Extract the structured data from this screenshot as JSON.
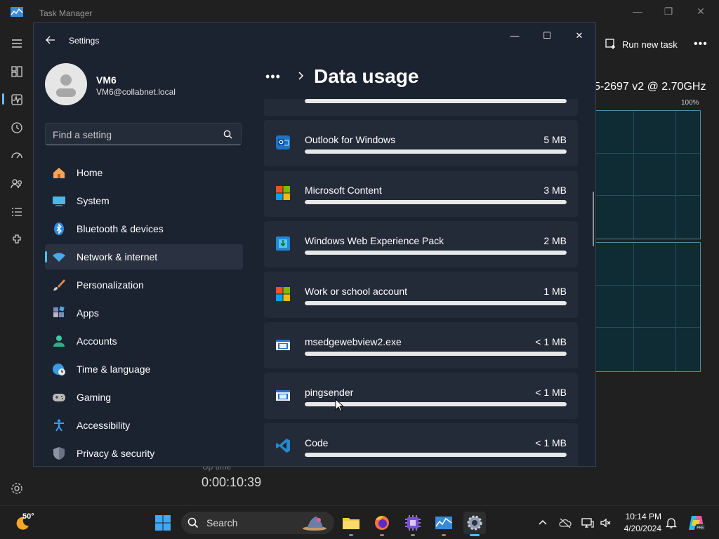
{
  "task_manager": {
    "title": "Task Manager",
    "run_new_task": "Run new task",
    "more": "•••",
    "cpu_name": "5-2697 v2 @ 2.70GHz",
    "graph_max": "100%",
    "uptime_label": "Up time",
    "uptime_value": "0:00:10:39"
  },
  "settings": {
    "title": "Settings",
    "user_name": "VM6",
    "user_email": "VM6@collabnet.local",
    "search_placeholder": "Find a setting",
    "breadcrumb_more": "•••",
    "page_title": "Data usage",
    "nav": [
      {
        "label": "Home",
        "icon": "home-icon"
      },
      {
        "label": "System",
        "icon": "system-icon"
      },
      {
        "label": "Bluetooth & devices",
        "icon": "bluetooth-icon"
      },
      {
        "label": "Network & internet",
        "icon": "wifi-icon",
        "selected": true
      },
      {
        "label": "Personalization",
        "icon": "brush-icon"
      },
      {
        "label": "Apps",
        "icon": "apps-icon"
      },
      {
        "label": "Accounts",
        "icon": "accounts-icon"
      },
      {
        "label": "Time & language",
        "icon": "globe-clock-icon"
      },
      {
        "label": "Gaming",
        "icon": "gamepad-icon"
      },
      {
        "label": "Accessibility",
        "icon": "accessibility-icon"
      },
      {
        "label": "Privacy & security",
        "icon": "shield-icon"
      }
    ],
    "apps": [
      {
        "name": "",
        "size": "",
        "usage": 1.0,
        "icon": "app-icon"
      },
      {
        "name": "Outlook for Windows",
        "size": "5 MB",
        "usage": 1.0,
        "icon": "outlook-icon"
      },
      {
        "name": "Microsoft Content",
        "size": "3 MB",
        "usage": 1.0,
        "icon": "microsoft-logo-icon"
      },
      {
        "name": "Windows Web Experience Pack",
        "size": "2 MB",
        "usage": 1.0,
        "icon": "web-experience-icon"
      },
      {
        "name": "Work or school account",
        "size": "1 MB",
        "usage": 1.0,
        "icon": "microsoft-logo-icon"
      },
      {
        "name": "msedgewebview2.exe",
        "size": "< 1 MB",
        "usage": 1.0,
        "icon": "exe-window-icon"
      },
      {
        "name": "pingsender",
        "size": "< 1 MB",
        "usage": 1.0,
        "icon": "exe-window-icon"
      },
      {
        "name": "Code",
        "size": "< 1 MB",
        "usage": 1.0,
        "icon": "vscode-icon"
      }
    ]
  },
  "taskbar": {
    "temperature": "50°",
    "search_label": "Search",
    "time": "10:14 PM",
    "date": "4/20/2024"
  },
  "colors": {
    "accent": "#4cc2ff",
    "settings_bg": "#1b2230",
    "card_bg": "#232a38",
    "taskbar_bg": "#1f1f1f"
  }
}
